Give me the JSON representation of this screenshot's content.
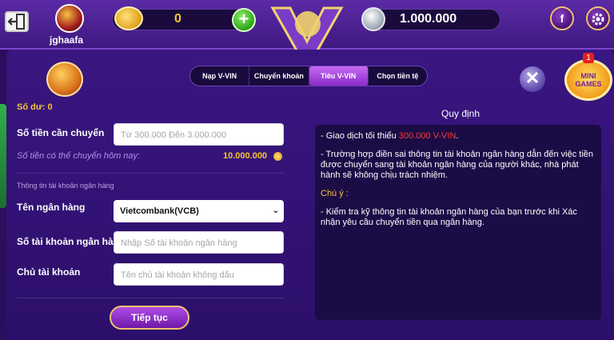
{
  "header": {
    "username": "jghaafa",
    "coin_balance": "0",
    "silver_balance": "1.000.000",
    "add_label": "+",
    "facebook_label": "f",
    "mini_games_label_1": "MINI",
    "mini_games_label_2": "GAMES",
    "mini_games_badge": "1"
  },
  "tabs": [
    {
      "label": "Nạp V-VIN",
      "active": false
    },
    {
      "label": "Chuyển khoản",
      "active": false
    },
    {
      "label": "Tiêu V-VIN",
      "active": true
    },
    {
      "label": "Chọn tiền tệ",
      "active": false
    }
  ],
  "form": {
    "balance_label": "Số dư: 0",
    "amount_label": "Số tiền cần chuyển",
    "amount_placeholder": "Từ 300.000 Đến 3.000.000",
    "today_label": "Số tiền có thể chuyển hôm nay:",
    "today_value": "10.000.000",
    "bank_section_title": "Thông tin tài khoản ngân hàng",
    "bank_name_label": "Tên ngân hàng",
    "bank_name_value": "Vietcombank(VCB)",
    "account_number_label": "Số tài khoản ngân hàng",
    "account_number_placeholder": "Nhập Số tài khoản ngân hàng",
    "account_holder_label": "Chủ tài khoản",
    "account_holder_placeholder": "Tên chủ tài khoản không dấu",
    "submit_label": "Tiếp tục"
  },
  "rules": {
    "title": "Quy định",
    "line1_prefix": "- Giao dịch tối thiểu ",
    "line1_highlight": "300.000 V-VIN",
    "line1_suffix": ".",
    "line2": "- Trường hợp điền sai thông tin tài khoản ngân hàng dẫn đến việc tiền được chuyển sang tài khoản ngân hàng của người khác, nhà phát hành sẽ không chịu trách nhiệm.",
    "note_title": "Chú ý :",
    "line3": "- Kiểm tra kỹ thông tin tài khoản ngân hàng của bạn trước khi Xác nhận yêu cầu chuyển tiền qua ngân hàng."
  },
  "colors": {
    "accent_gold": "#f7c531",
    "highlight_red": "#ff3b3b",
    "panel_purple": "#3a1681"
  },
  "icons": [
    "exit-icon",
    "avatar",
    "gold-coin-icon",
    "plus-icon",
    "v88-logo",
    "silver-coin-icon",
    "facebook-icon",
    "gear-icon",
    "trophy-icon",
    "close-icon",
    "mini-games-icon",
    "chevron-down-icon"
  ]
}
